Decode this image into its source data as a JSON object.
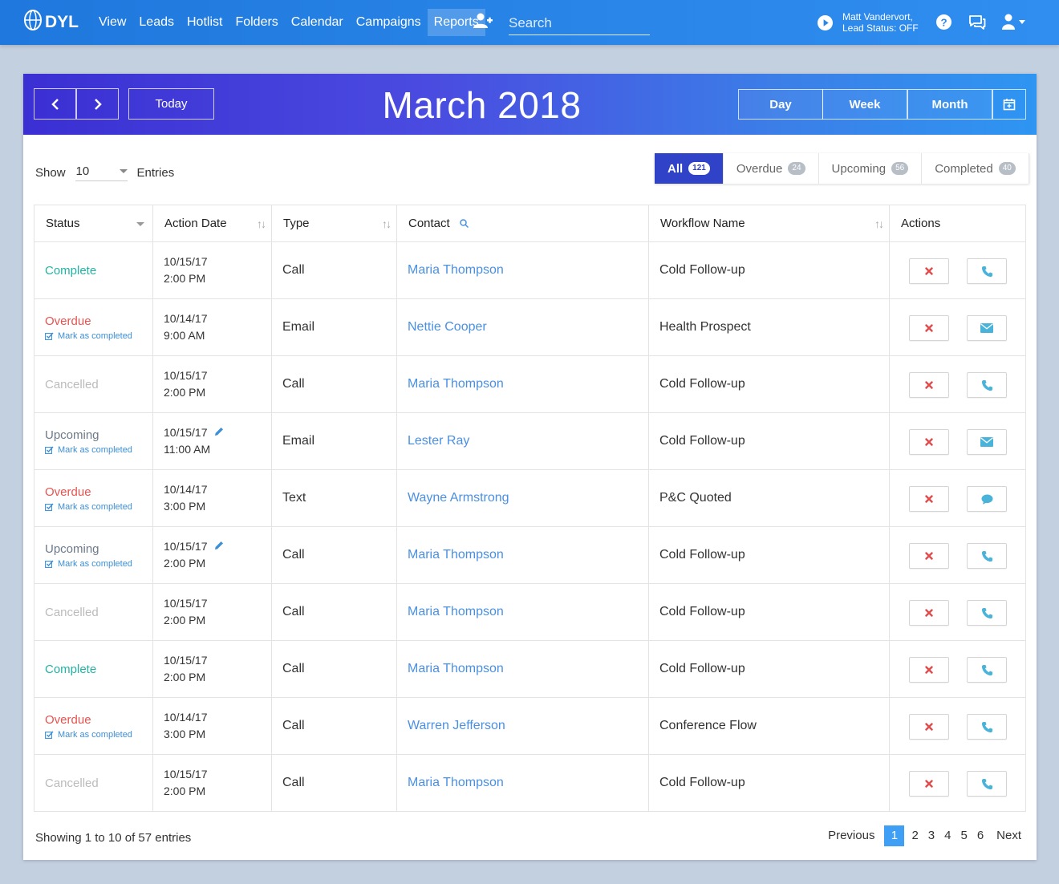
{
  "brand": {
    "name": "DYL"
  },
  "nav": {
    "items": [
      {
        "label": "View"
      },
      {
        "label": "Leads"
      },
      {
        "label": "Hotlist"
      },
      {
        "label": "Folders"
      },
      {
        "label": "Calendar"
      },
      {
        "label": "Campaigns"
      },
      {
        "label": "Reports",
        "active": true
      }
    ],
    "search_placeholder": "Search",
    "user_name": "Matt Vandervort,",
    "lead_status": "Lead Status: OFF"
  },
  "calendar": {
    "title": "March 2018",
    "today_label": "Today",
    "views": {
      "day": "Day",
      "week": "Week",
      "month": "Month"
    }
  },
  "entries": {
    "show_label": "Show",
    "count": "10",
    "entries_label": "Entries"
  },
  "filters": [
    {
      "label": "All",
      "count": "121",
      "active": true
    },
    {
      "label": "Overdue",
      "count": "24"
    },
    {
      "label": "Upcoming",
      "count": "56"
    },
    {
      "label": "Completed",
      "count": "40"
    }
  ],
  "table": {
    "columns": {
      "status": "Status",
      "action_date": "Action Date",
      "type": "Type",
      "contact": "Contact",
      "workflow": "Workflow Name",
      "actions": "Actions"
    },
    "mark_label": "Mark as completed",
    "rows": [
      {
        "status": "Complete",
        "date": "10/15/17",
        "time": "2:00 PM",
        "type": "Call",
        "contact": "Maria Thompson",
        "workflow": "Cold Follow-up"
      },
      {
        "status": "Overdue",
        "date": "10/14/17",
        "time": "9:00 AM",
        "type": "Email",
        "contact": "Nettie Cooper",
        "workflow": "Health Prospect"
      },
      {
        "status": "Cancelled",
        "date": "10/15/17",
        "time": "2:00 PM",
        "type": "Call",
        "contact": "Maria Thompson",
        "workflow": "Cold Follow-up"
      },
      {
        "status": "Upcoming",
        "date": "10/15/17",
        "time": "11:00 AM",
        "type": "Email",
        "contact": "Lester Ray",
        "workflow": "Cold Follow-up"
      },
      {
        "status": "Overdue",
        "date": "10/14/17",
        "time": "3:00 PM",
        "type": "Text",
        "contact": "Wayne Armstrong",
        "workflow": "P&C Quoted"
      },
      {
        "status": "Upcoming",
        "date": "10/15/17",
        "time": "2:00 PM",
        "type": "Call",
        "contact": "Maria Thompson",
        "workflow": "Cold Follow-up"
      },
      {
        "status": "Cancelled",
        "date": "10/15/17",
        "time": "2:00 PM",
        "type": "Call",
        "contact": "Maria Thompson",
        "workflow": "Cold Follow-up"
      },
      {
        "status": "Complete",
        "date": "10/15/17",
        "time": "2:00 PM",
        "type": "Call",
        "contact": "Maria Thompson",
        "workflow": "Cold Follow-up"
      },
      {
        "status": "Overdue",
        "date": "10/14/17",
        "time": "3:00 PM",
        "type": "Call",
        "contact": "Warren Jefferson",
        "workflow": "Conference Flow"
      },
      {
        "status": "Cancelled",
        "date": "10/15/17",
        "time": "2:00 PM",
        "type": "Call",
        "contact": "Maria Thompson",
        "workflow": "Cold Follow-up"
      }
    ]
  },
  "footer": {
    "showing": "Showing 1 to 10 of 57 entries",
    "prev": "Previous",
    "next": "Next",
    "pages": [
      "1",
      "2",
      "3",
      "4",
      "5",
      "6"
    ],
    "current_page": "1"
  },
  "colors": {
    "nav_bg": "#2a86e8",
    "header_gradient_start": "#3b2fd3",
    "header_gradient_end": "#2e95f2",
    "complete": "#22b3a3",
    "overdue": "#e8534f",
    "cancelled": "#bbbbbb",
    "upcoming": "#6c7a89",
    "link": "#4a90e2"
  }
}
